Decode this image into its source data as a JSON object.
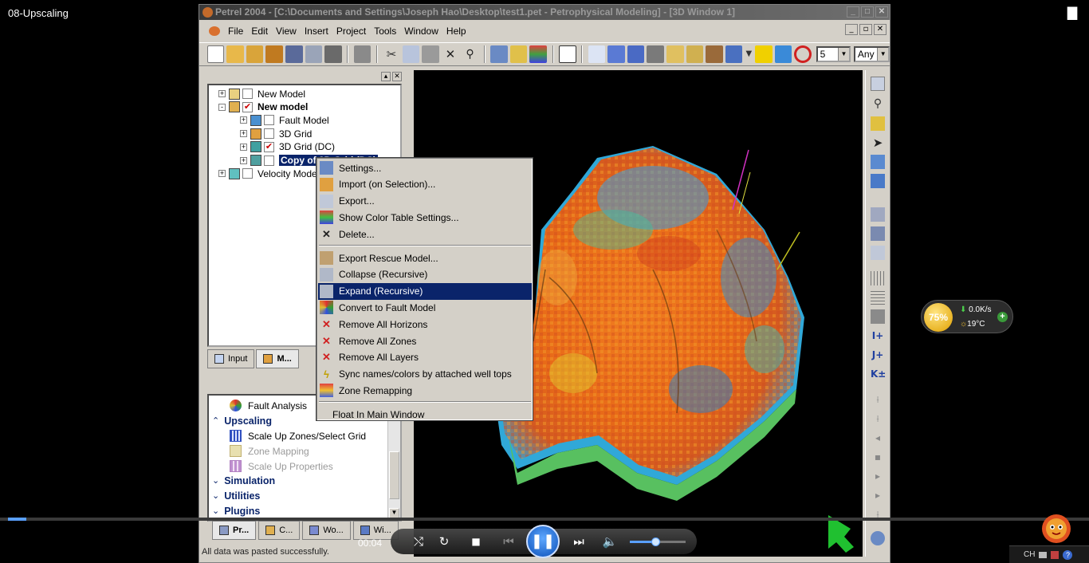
{
  "player": {
    "title": "08-Upscaling",
    "time": "00:04",
    "progress_fraction": 0.017,
    "volume_fraction": 0.45
  },
  "window": {
    "title": "Petrel 2004 - [C:\\Documents and Settings\\Joseph Hao\\Desktop\\test1.pet - Petrophysical Modeling] - [3D Window 1]"
  },
  "menu": [
    "File",
    "Edit",
    "View",
    "Insert",
    "Project",
    "Tools",
    "Window",
    "Help"
  ],
  "toolbar": {
    "combo1": "5",
    "combo2": "Any"
  },
  "tree": [
    {
      "label": "New Model",
      "level": 0,
      "expander": "+",
      "checked": false
    },
    {
      "label": "New model",
      "level": 0,
      "expander": "-",
      "checked": true,
      "bold": true
    },
    {
      "label": "Fault Model",
      "level": 1,
      "expander": "+",
      "checked": false
    },
    {
      "label": "3D Grid",
      "level": 1,
      "expander": "+",
      "checked": false
    },
    {
      "label": "3D Grid (DC)",
      "level": 1,
      "expander": "+",
      "checked": true
    },
    {
      "label": "Copy of 3D Grid (DC)",
      "level": 1,
      "expander": "+",
      "checked": false,
      "selected": true
    },
    {
      "label": "Velocity Model",
      "level": 0,
      "expander": "+",
      "checked": false
    }
  ],
  "tree_tabs": [
    "Input",
    "M..."
  ],
  "context_menu": [
    {
      "label": "Settings...",
      "icon": "settings-icon"
    },
    {
      "label": "Import (on Selection)...",
      "icon": "import-icon"
    },
    {
      "label": "Export...",
      "icon": "export-icon"
    },
    {
      "label": "Show Color Table Settings...",
      "icon": "color-table-icon"
    },
    {
      "label": "Delete...",
      "icon": "delete-icon"
    },
    {
      "label": "Export Rescue Model...",
      "icon": "rescue-export-icon"
    },
    {
      "label": "Collapse (Recursive)",
      "icon": "collapse-icon"
    },
    {
      "label": "Expand (Recursive)",
      "icon": "expand-icon",
      "highlighted": true
    },
    {
      "label": "Convert to Fault Model",
      "icon": "fault-model-icon"
    },
    {
      "label": "Remove All Horizons",
      "icon": "remove-icon"
    },
    {
      "label": "Remove All Zones",
      "icon": "remove-icon"
    },
    {
      "label": "Remove All Layers",
      "icon": "remove-icon"
    },
    {
      "label": "Sync names/colors by attached well tops",
      "icon": "sync-icon"
    },
    {
      "label": "Zone Remapping",
      "icon": "zone-remap-icon"
    },
    {
      "label": "Float In Main Window",
      "icon": ""
    }
  ],
  "processes": {
    "fault_analysis": "Fault Analysis",
    "upscaling": "Upscaling",
    "scale_up_zones": "Scale Up Zones/Select Grid",
    "zone_mapping": "Zone Mapping",
    "scale_up_properties": "Scale Up Properties",
    "simulation": "Simulation",
    "utilities": "Utilities",
    "plugins": "Plugins"
  },
  "bottom_tabs": [
    "Pr...",
    "C...",
    "Wo...",
    "Wi..."
  ],
  "status": "All data was pasted successfully.",
  "widget": {
    "percent": "75%",
    "net": "0.0K/s",
    "temp": "19°C"
  },
  "tray": {
    "lang": "CH"
  }
}
